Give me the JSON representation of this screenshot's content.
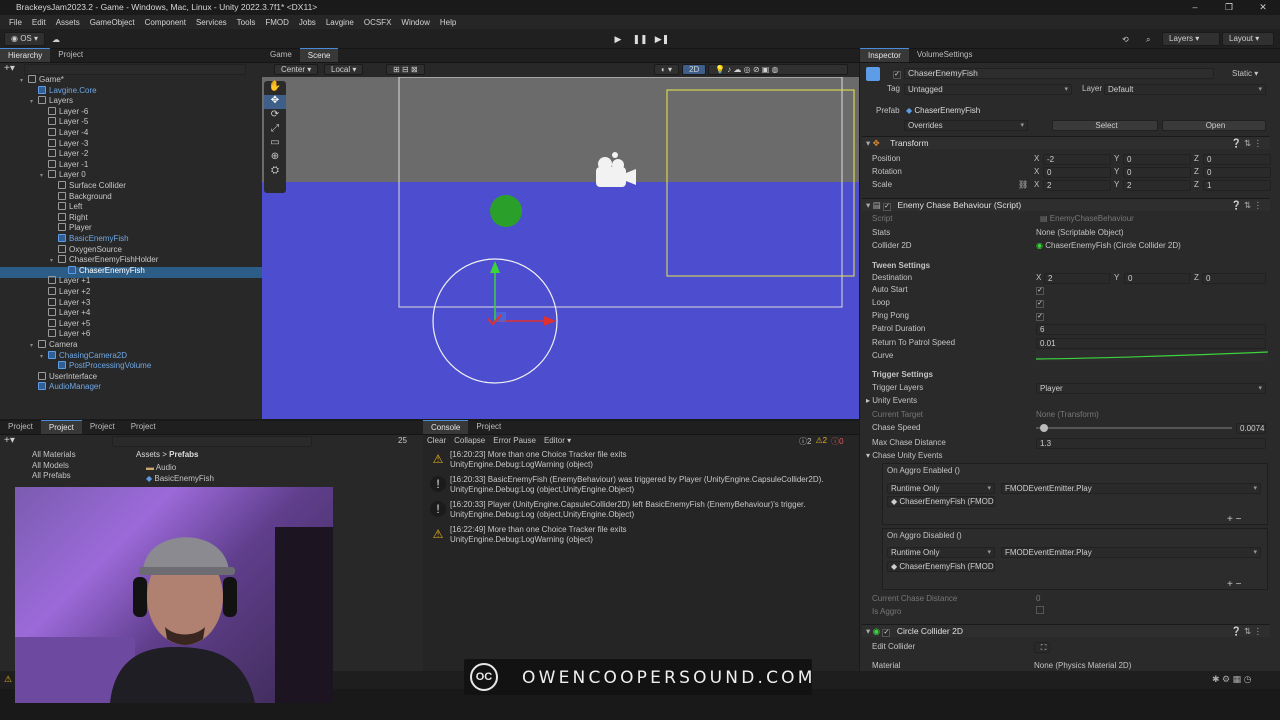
{
  "window": {
    "title": "BrackeysJam2023.2 - Game - Windows, Mac, Linux - Unity 2022.3.7f1* <DX11>",
    "controls": [
      "–",
      "❐",
      "✕"
    ]
  },
  "menu": [
    "File",
    "Edit",
    "Assets",
    "GameObject",
    "Component",
    "Services",
    "Tools",
    "FMOD",
    "Jobs",
    "Lavgine",
    "OCSFX",
    "Window",
    "Help"
  ],
  "toolbar": {
    "account": "OS",
    "layers": "Layers",
    "layout": "Layout"
  },
  "hierarchy": {
    "tabs": [
      "Hierarchy",
      "Project"
    ],
    "rows": [
      {
        "label": "Game*",
        "indent": 0,
        "blue": false
      },
      {
        "label": "Lavgine.Core",
        "indent": 1,
        "blue": true
      },
      {
        "label": "Layers",
        "indent": 1,
        "blue": false
      },
      {
        "label": "Layer -6",
        "indent": 2,
        "blue": false
      },
      {
        "label": "Layer -5",
        "indent": 2,
        "blue": false
      },
      {
        "label": "Layer -4",
        "indent": 2,
        "blue": false
      },
      {
        "label": "Layer -3",
        "indent": 2,
        "blue": false
      },
      {
        "label": "Layer -2",
        "indent": 2,
        "blue": false
      },
      {
        "label": "Layer -1",
        "indent": 2,
        "blue": false
      },
      {
        "label": "Layer 0",
        "indent": 2,
        "blue": false
      },
      {
        "label": "Surface Collider",
        "indent": 3,
        "blue": false
      },
      {
        "label": "Background",
        "indent": 3,
        "blue": false
      },
      {
        "label": "Left",
        "indent": 3,
        "blue": false
      },
      {
        "label": "Right",
        "indent": 3,
        "blue": false
      },
      {
        "label": "Player",
        "indent": 3,
        "blue": false
      },
      {
        "label": "BasicEnemyFish",
        "indent": 3,
        "blue": true
      },
      {
        "label": "OxygenSource",
        "indent": 3,
        "blue": false
      },
      {
        "label": "ChaserEnemyFishHolder",
        "indent": 3,
        "blue": false
      },
      {
        "label": "ChaserEnemyFish",
        "indent": 4,
        "blue": true
      },
      {
        "label": "Layer +1",
        "indent": 2,
        "blue": false
      },
      {
        "label": "Layer +2",
        "indent": 2,
        "blue": false
      },
      {
        "label": "Layer +3",
        "indent": 2,
        "blue": false
      },
      {
        "label": "Layer +4",
        "indent": 2,
        "blue": false
      },
      {
        "label": "Layer +5",
        "indent": 2,
        "blue": false
      },
      {
        "label": "Layer +6",
        "indent": 2,
        "blue": false
      },
      {
        "label": "Camera",
        "indent": 1,
        "blue": false
      },
      {
        "label": "ChasingCamera2D",
        "indent": 2,
        "blue": true
      },
      {
        "label": "PostProcessingVolume",
        "indent": 3,
        "blue": true
      },
      {
        "label": "UserInterface",
        "indent": 1,
        "blue": false
      },
      {
        "label": "AudioManager",
        "indent": 1,
        "blue": true
      }
    ]
  },
  "scene": {
    "tabs": [
      "Game",
      "Scene"
    ],
    "pivot": "Center",
    "space": "Local",
    "mode2d": "2D"
  },
  "project": {
    "tabs": [
      "Project",
      "Project",
      "Project",
      "Project"
    ],
    "favorites": [
      "All Materials",
      "All Models",
      "All Prefabs"
    ],
    "breadcrumb": [
      "Assets",
      "Prefabs"
    ],
    "items": [
      "Audio",
      "BasicEnemyFish"
    ],
    "count": "25"
  },
  "console": {
    "tabs": [
      "Console",
      "Project"
    ],
    "buttons": [
      "Clear",
      "Collapse",
      "Error Pause",
      "Editor"
    ],
    "warn_count": "2",
    "info_count": "2",
    "error_count": "0",
    "messages": [
      {
        "type": "warn",
        "line1": "[16:20:23] More than one Choice Tracker file exits",
        "line2": "UnityEngine.Debug:LogWarning (object)"
      },
      {
        "type": "info",
        "line1": "[16:20:33] BasicEnemyFish (EnemyBehaviour) was triggered by Player (UnityEngine.CapsuleCollider2D).",
        "line2": "UnityEngine.Debug:Log (object,UnityEngine.Object)"
      },
      {
        "type": "info",
        "line1": "[16:20:33] Player (UnityEngine.CapsuleCollider2D) left BasicEnemyFish (EnemyBehaviour)'s trigger.",
        "line2": "UnityEngine.Debug:Log (object,UnityEngine.Object)"
      },
      {
        "type": "warn",
        "line1": "[16:22:49] More than one Choice Tracker file exits",
        "line2": "UnityEngine.Debug:LogWarning (object)"
      }
    ]
  },
  "inspector": {
    "tabs": [
      "Inspector",
      "VolumeSettings"
    ],
    "object_name": "ChaserEnemyFish",
    "static_label": "Static",
    "tag_label": "Tag",
    "tag_value": "Untagged",
    "layer_label": "Layer",
    "layer_value": "Default",
    "prefab_label": "Prefab",
    "prefab_value": "ChaserEnemyFish",
    "overrides": "Overrides",
    "select": "Select",
    "open": "Open",
    "transform": {
      "title": "Transform",
      "position": {
        "label": "Position",
        "x": "-2",
        "y": "0",
        "z": "0"
      },
      "rotation": {
        "label": "Rotation",
        "x": "0",
        "y": "0",
        "z": "0"
      },
      "scale": {
        "label": "Scale",
        "x": "2",
        "y": "2",
        "z": "1"
      }
    },
    "script_comp": {
      "title": "Enemy Chase Behaviour (Script)",
      "script_label": "Script",
      "script_value": "EnemyChaseBehaviour",
      "stats_label": "Stats",
      "stats_value": "None (Scriptable Object)",
      "collider_label": "Collider 2D",
      "collider_value": "ChaserEnemyFish (Circle Collider 2D)",
      "tween_header": "Tween Settings",
      "destination_label": "Destination",
      "dest_x": "2",
      "dest_y": "0",
      "dest_z": "0",
      "autostart_label": "Auto Start",
      "loop_label": "Loop",
      "pingpong_label": "Ping Pong",
      "patrol_label": "Patrol Duration",
      "patrol_value": "6",
      "return_label": "Return To Patrol Speed",
      "return_value": "0.01",
      "curve_label": "Curve",
      "trigger_header": "Trigger Settings",
      "trigger_layers_label": "Trigger Layers",
      "trigger_layers_value": "Player",
      "unity_events": "Unity Events",
      "current_target_label": "Current Target",
      "current_target_value": "None (Transform)",
      "chase_speed_label": "Chase Speed",
      "chase_speed_value": "0.0074",
      "chase_speed_fraction": 0.04,
      "max_chase_label": "Max Chase Distance",
      "max_chase_value": "1.3",
      "chase_events": "Chase Unity Events",
      "aggro_enabled": "On Aggro Enabled ()",
      "aggro_disabled": "On Aggro Disabled ()",
      "runtime_only": "Runtime Only",
      "fmod_method": "FMODEventEmitter.Play",
      "fmod_target": "ChaserEnemyFish (FMOD",
      "current_chase_label": "Current Chase Distance",
      "current_chase_value": "0",
      "is_aggro_label": "Is Aggro"
    },
    "circle_comp": {
      "title": "Circle Collider 2D",
      "edit_label": "Edit Collider",
      "material_label": "Material",
      "material_value": "None (Physics Material 2D)"
    }
  },
  "banner": {
    "logo": "OC",
    "text": "OWENCOOPERSOUND.COM"
  },
  "colors": {
    "selection": "#2c5d87",
    "water": "#4d4dd0",
    "accent": "#4a8cdb"
  }
}
